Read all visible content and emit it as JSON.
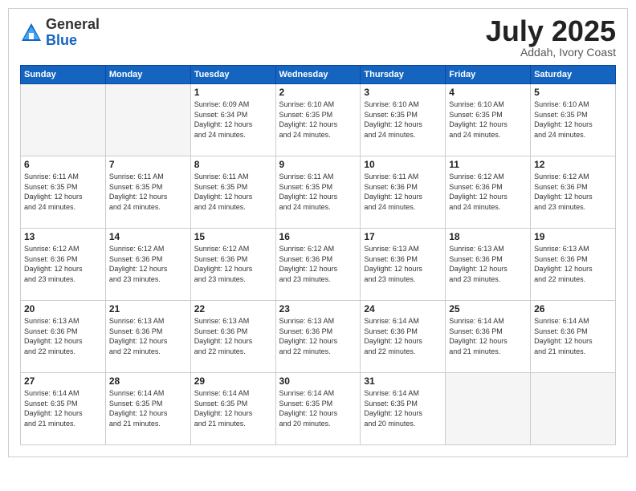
{
  "header": {
    "logo_general": "General",
    "logo_blue": "Blue",
    "month_title": "July 2025",
    "location": "Addah, Ivory Coast"
  },
  "weekdays": [
    "Sunday",
    "Monday",
    "Tuesday",
    "Wednesday",
    "Thursday",
    "Friday",
    "Saturday"
  ],
  "weeks": [
    [
      {
        "day": "",
        "text": ""
      },
      {
        "day": "",
        "text": ""
      },
      {
        "day": "1",
        "text": "Sunrise: 6:09 AM\nSunset: 6:34 PM\nDaylight: 12 hours\nand 24 minutes."
      },
      {
        "day": "2",
        "text": "Sunrise: 6:10 AM\nSunset: 6:35 PM\nDaylight: 12 hours\nand 24 minutes."
      },
      {
        "day": "3",
        "text": "Sunrise: 6:10 AM\nSunset: 6:35 PM\nDaylight: 12 hours\nand 24 minutes."
      },
      {
        "day": "4",
        "text": "Sunrise: 6:10 AM\nSunset: 6:35 PM\nDaylight: 12 hours\nand 24 minutes."
      },
      {
        "day": "5",
        "text": "Sunrise: 6:10 AM\nSunset: 6:35 PM\nDaylight: 12 hours\nand 24 minutes."
      }
    ],
    [
      {
        "day": "6",
        "text": "Sunrise: 6:11 AM\nSunset: 6:35 PM\nDaylight: 12 hours\nand 24 minutes."
      },
      {
        "day": "7",
        "text": "Sunrise: 6:11 AM\nSunset: 6:35 PM\nDaylight: 12 hours\nand 24 minutes."
      },
      {
        "day": "8",
        "text": "Sunrise: 6:11 AM\nSunset: 6:35 PM\nDaylight: 12 hours\nand 24 minutes."
      },
      {
        "day": "9",
        "text": "Sunrise: 6:11 AM\nSunset: 6:35 PM\nDaylight: 12 hours\nand 24 minutes."
      },
      {
        "day": "10",
        "text": "Sunrise: 6:11 AM\nSunset: 6:36 PM\nDaylight: 12 hours\nand 24 minutes."
      },
      {
        "day": "11",
        "text": "Sunrise: 6:12 AM\nSunset: 6:36 PM\nDaylight: 12 hours\nand 24 minutes."
      },
      {
        "day": "12",
        "text": "Sunrise: 6:12 AM\nSunset: 6:36 PM\nDaylight: 12 hours\nand 23 minutes."
      }
    ],
    [
      {
        "day": "13",
        "text": "Sunrise: 6:12 AM\nSunset: 6:36 PM\nDaylight: 12 hours\nand 23 minutes."
      },
      {
        "day": "14",
        "text": "Sunrise: 6:12 AM\nSunset: 6:36 PM\nDaylight: 12 hours\nand 23 minutes."
      },
      {
        "day": "15",
        "text": "Sunrise: 6:12 AM\nSunset: 6:36 PM\nDaylight: 12 hours\nand 23 minutes."
      },
      {
        "day": "16",
        "text": "Sunrise: 6:12 AM\nSunset: 6:36 PM\nDaylight: 12 hours\nand 23 minutes."
      },
      {
        "day": "17",
        "text": "Sunrise: 6:13 AM\nSunset: 6:36 PM\nDaylight: 12 hours\nand 23 minutes."
      },
      {
        "day": "18",
        "text": "Sunrise: 6:13 AM\nSunset: 6:36 PM\nDaylight: 12 hours\nand 23 minutes."
      },
      {
        "day": "19",
        "text": "Sunrise: 6:13 AM\nSunset: 6:36 PM\nDaylight: 12 hours\nand 22 minutes."
      }
    ],
    [
      {
        "day": "20",
        "text": "Sunrise: 6:13 AM\nSunset: 6:36 PM\nDaylight: 12 hours\nand 22 minutes."
      },
      {
        "day": "21",
        "text": "Sunrise: 6:13 AM\nSunset: 6:36 PM\nDaylight: 12 hours\nand 22 minutes."
      },
      {
        "day": "22",
        "text": "Sunrise: 6:13 AM\nSunset: 6:36 PM\nDaylight: 12 hours\nand 22 minutes."
      },
      {
        "day": "23",
        "text": "Sunrise: 6:13 AM\nSunset: 6:36 PM\nDaylight: 12 hours\nand 22 minutes."
      },
      {
        "day": "24",
        "text": "Sunrise: 6:14 AM\nSunset: 6:36 PM\nDaylight: 12 hours\nand 22 minutes."
      },
      {
        "day": "25",
        "text": "Sunrise: 6:14 AM\nSunset: 6:36 PM\nDaylight: 12 hours\nand 21 minutes."
      },
      {
        "day": "26",
        "text": "Sunrise: 6:14 AM\nSunset: 6:36 PM\nDaylight: 12 hours\nand 21 minutes."
      }
    ],
    [
      {
        "day": "27",
        "text": "Sunrise: 6:14 AM\nSunset: 6:35 PM\nDaylight: 12 hours\nand 21 minutes."
      },
      {
        "day": "28",
        "text": "Sunrise: 6:14 AM\nSunset: 6:35 PM\nDaylight: 12 hours\nand 21 minutes."
      },
      {
        "day": "29",
        "text": "Sunrise: 6:14 AM\nSunset: 6:35 PM\nDaylight: 12 hours\nand 21 minutes."
      },
      {
        "day": "30",
        "text": "Sunrise: 6:14 AM\nSunset: 6:35 PM\nDaylight: 12 hours\nand 20 minutes."
      },
      {
        "day": "31",
        "text": "Sunrise: 6:14 AM\nSunset: 6:35 PM\nDaylight: 12 hours\nand 20 minutes."
      },
      {
        "day": "",
        "text": ""
      },
      {
        "day": "",
        "text": ""
      }
    ]
  ]
}
